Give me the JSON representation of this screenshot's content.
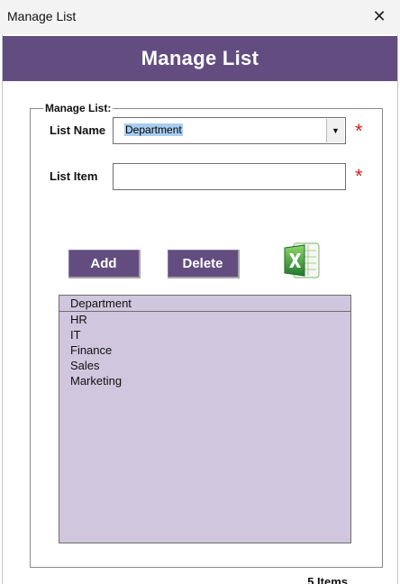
{
  "window": {
    "title": "Manage List",
    "close_glyph": "✕"
  },
  "header": {
    "title": "Manage List"
  },
  "group": {
    "legend": "Manage List:"
  },
  "list_name": {
    "label": "List Name",
    "value": "Department",
    "required_mark": "*"
  },
  "list_item": {
    "label": "List Item",
    "value": "",
    "required_mark": "*"
  },
  "buttons": {
    "add": "Add",
    "delete": "Delete"
  },
  "export": {
    "icon": "excel-icon"
  },
  "list": {
    "header": "Department",
    "items": [
      "HR",
      "IT",
      "Finance",
      "Sales",
      "Marketing"
    ]
  },
  "footer": {
    "count_text": "5 Items"
  },
  "colors": {
    "accent": "#634d80",
    "list_bg": "#d0c6de",
    "required": "#d32121"
  }
}
